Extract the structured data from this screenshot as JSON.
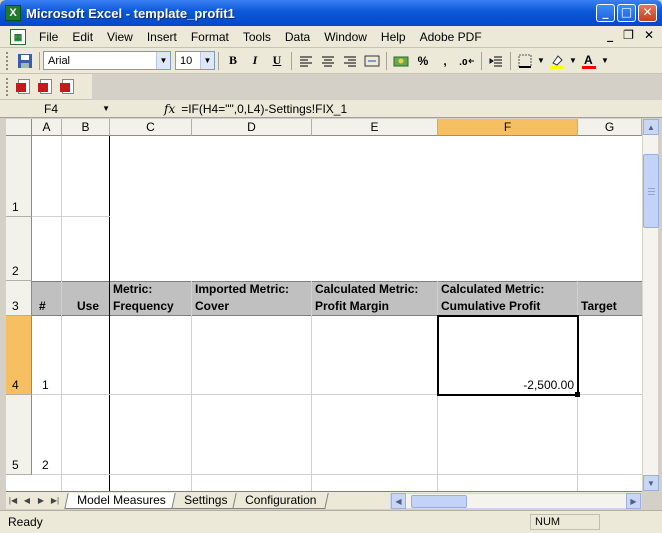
{
  "window": {
    "title": "Microsoft Excel - template_profit1",
    "minimize": "_",
    "maximize": "□",
    "close": "✕",
    "app_icon_glyph": "X"
  },
  "menu": {
    "items": [
      "File",
      "Edit",
      "View",
      "Insert",
      "Format",
      "Tools",
      "Data",
      "Window",
      "Help",
      "Adobe PDF"
    ],
    "doc_min": "_",
    "doc_restore": "❐",
    "doc_close": "✕"
  },
  "toolbar": {
    "font_name": "Arial",
    "font_size": "10",
    "bold": "B",
    "italic": "I",
    "underline": "U",
    "percent": "%",
    "comma": ","
  },
  "formula_bar": {
    "name_box": "F4",
    "fx_label": "fx",
    "formula": "=IF(H4=\"\",0,L4)-Settings!FIX_1"
  },
  "grid": {
    "columns": [
      "A",
      "B",
      "C",
      "D",
      "E",
      "F",
      "G"
    ],
    "rows": [
      "1",
      "2",
      "3",
      "4",
      "5"
    ],
    "header_row": {
      "num": "#",
      "use": "Use",
      "metric_line1": "Metric:",
      "metric_line2": "Frequency",
      "imported_line1": "Imported Metric:",
      "imported_line2": "Cover",
      "calc1_line1": "Calculated Metric:",
      "calc1_line2": "Profit Margin",
      "calc2_line1": "Calculated Metric:",
      "calc2_line2": "Cumulative Profit",
      "target": "Target"
    },
    "row4": {
      "num": "1",
      "cumulative_profit": "-2,500.00"
    },
    "row5": {
      "num": "2"
    }
  },
  "sheets": {
    "tabs": [
      "Model Measures",
      "Settings",
      "Configuration"
    ],
    "active": "Model Measures"
  },
  "status": {
    "left": "Ready",
    "num": "NUM"
  },
  "colors": {
    "title_bar": "#0a58d8",
    "selected_header": "#f6c062",
    "header_band": "#c0c0c0"
  }
}
